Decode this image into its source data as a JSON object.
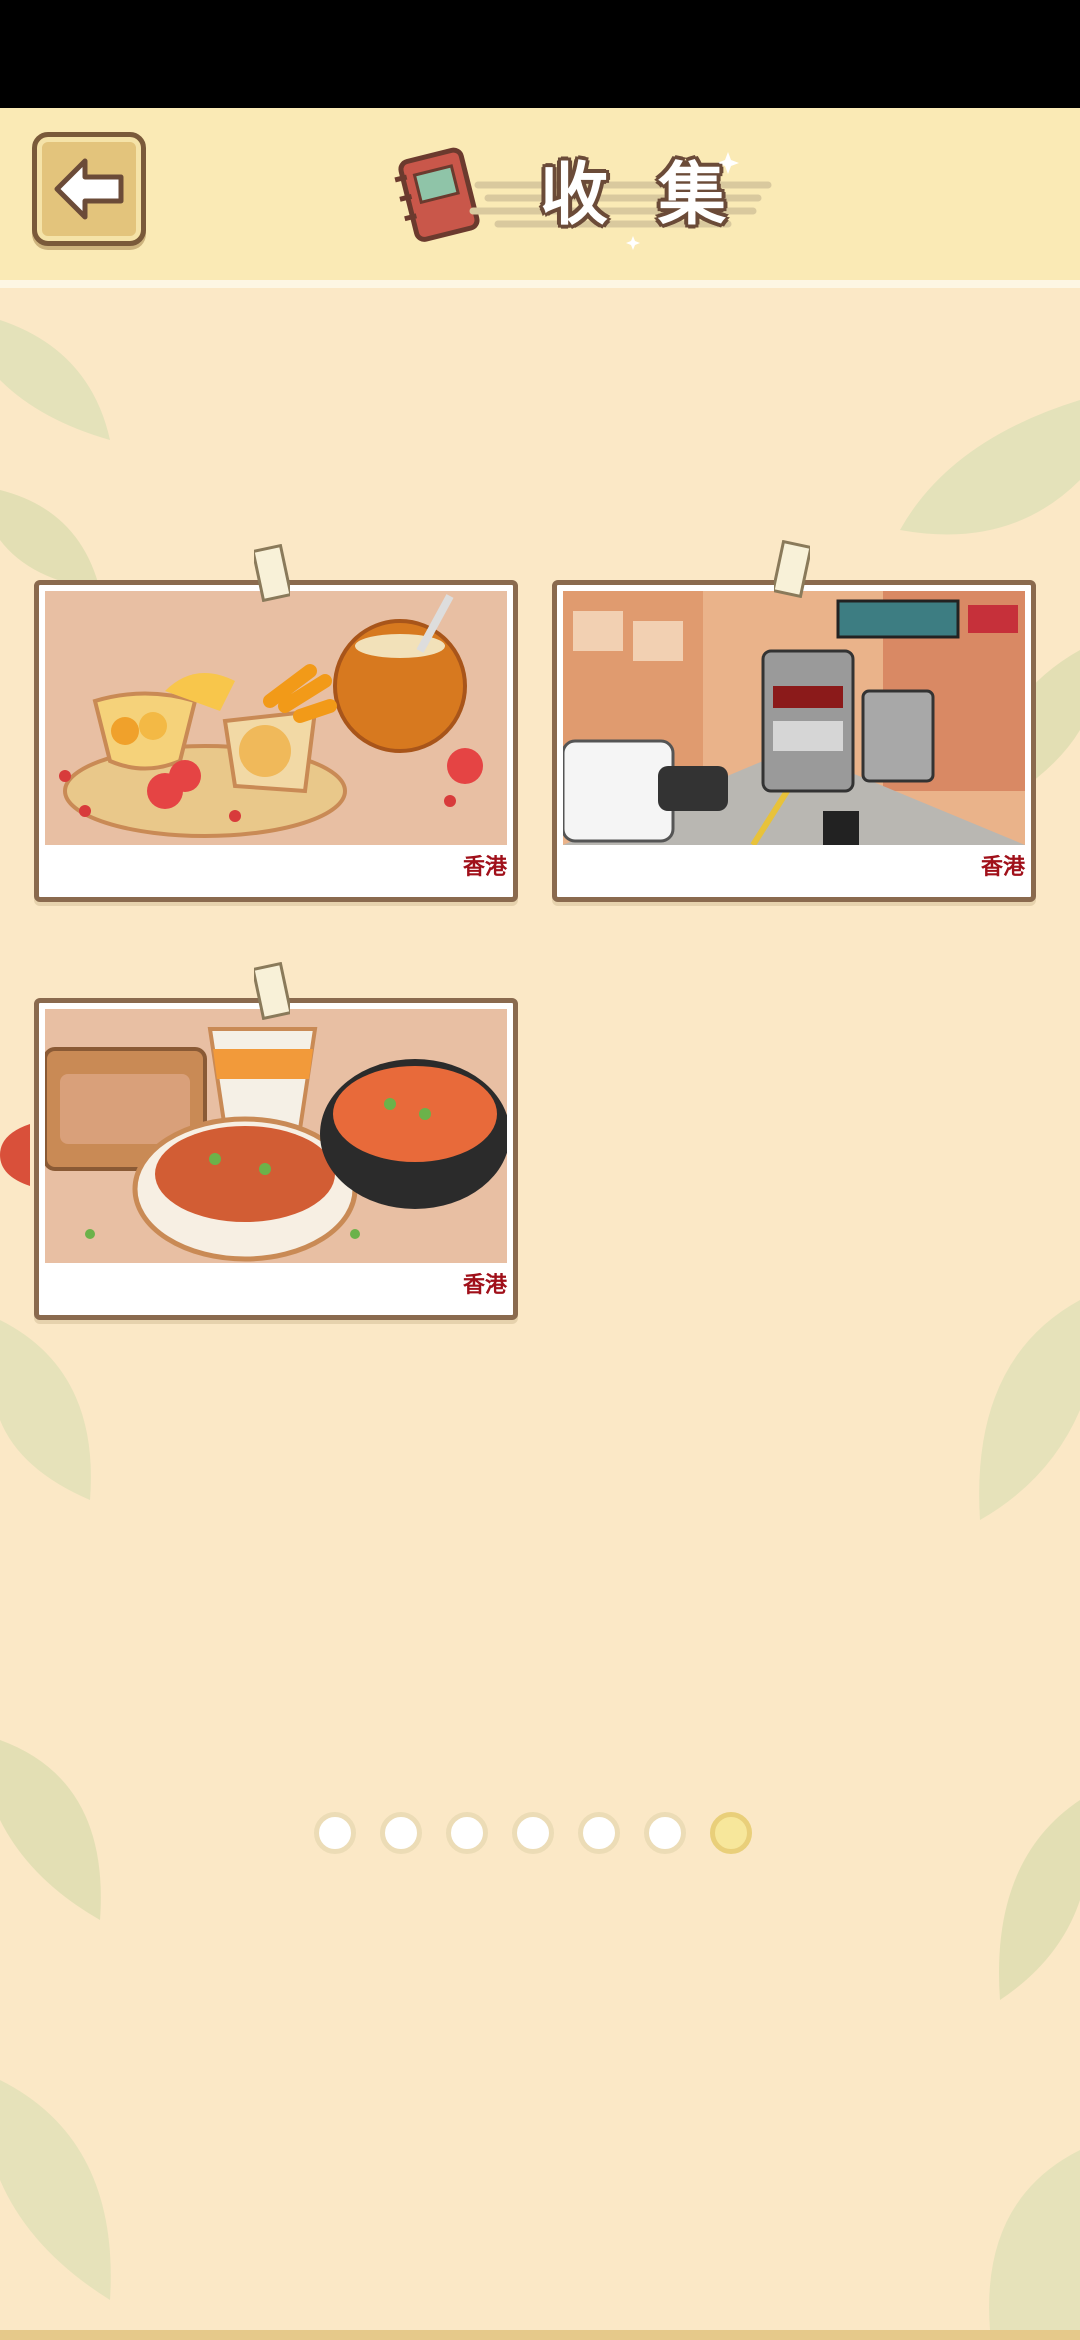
{
  "header": {
    "title_chars": [
      "收",
      "集"
    ],
    "back_icon": "left-arrow-icon",
    "notebook_icon": "notebook-icon"
  },
  "collection": {
    "cards": [
      {
        "label": "香港",
        "image": "hong-kong-dessert-illustration"
      },
      {
        "label": "香港",
        "image": "hong-kong-tram-street-illustration"
      },
      {
        "label": "香港",
        "image": "hong-kong-noodle-meal-illustration"
      }
    ]
  },
  "pagination": {
    "total": 7,
    "current": 7
  },
  "colors": {
    "background": "#fbe8c6",
    "header": "#faeab5",
    "card_border": "#8a6a4e",
    "label_red": "#a0101a",
    "active_dot": "#f7e79b"
  }
}
